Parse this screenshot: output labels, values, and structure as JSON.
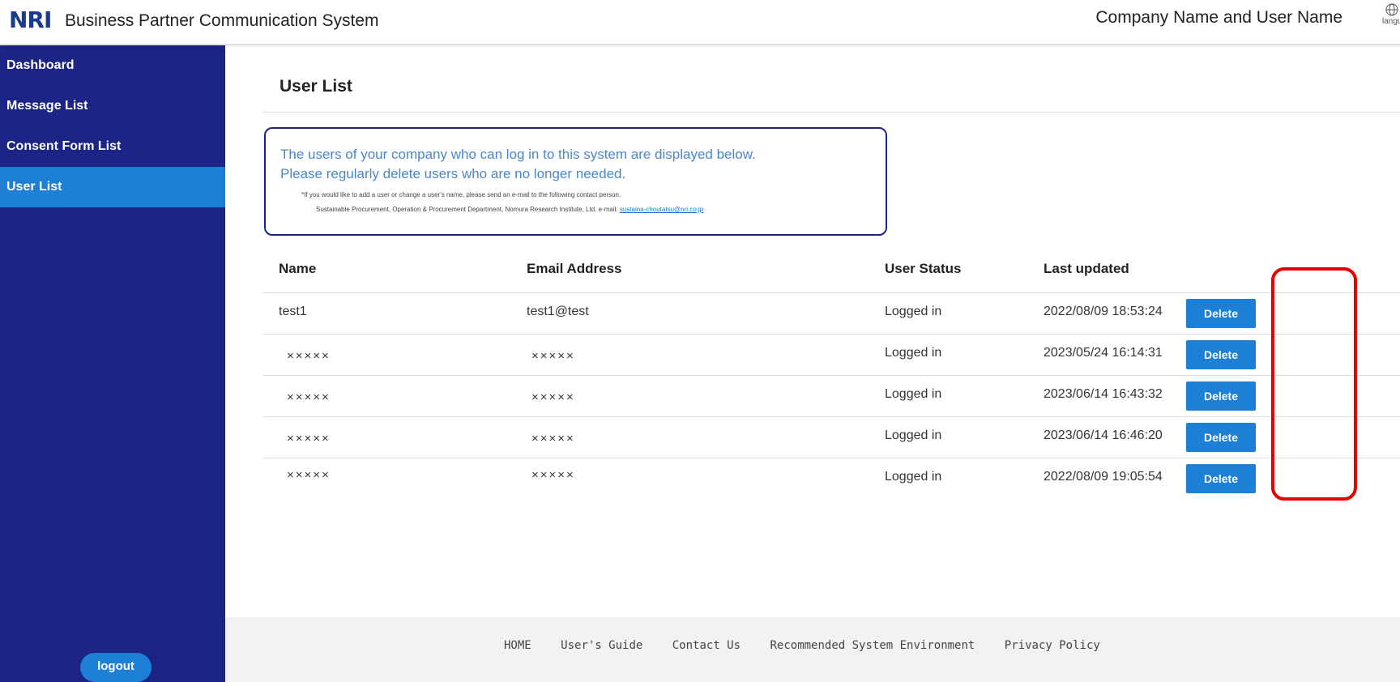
{
  "header": {
    "logo": "NRI",
    "system_title": "Business Partner Communication System",
    "user_label": "Company Name and User Name",
    "language_label": "langu"
  },
  "sidebar": {
    "items": [
      {
        "label": "Dashboard",
        "active": false
      },
      {
        "label": "Message List",
        "active": false
      },
      {
        "label": "Consent Form List",
        "active": false
      },
      {
        "label": "User List",
        "active": true
      }
    ],
    "logout_label": "logout"
  },
  "main": {
    "page_title": "User List",
    "info": {
      "line1": "The users of your company who can log in to this system are displayed below.",
      "line2": "Please regularly delete users who are no longer needed.",
      "note": "*If you would like to add a user or change a user's name, please send an e-mail to the following contact person.",
      "contact_prefix": "Sustainable Procurement, Operation & Procurement Department, Nomura Research Institute, Ltd. e-mail:",
      "contact_email": "sustaina-choutatsu@nri.co.jp"
    },
    "table": {
      "headers": {
        "name": "Name",
        "email": "Email Address",
        "status": "User Status",
        "updated": "Last updated"
      },
      "delete_label": "Delete",
      "rows": [
        {
          "name": "test1",
          "email": "test1@test",
          "status": "Logged in",
          "updated": "2022/08/09 18:53:24"
        },
        {
          "name": "×××××",
          "email": "×××××",
          "status": "Logged in",
          "updated": "2023/05/24 16:14:31"
        },
        {
          "name": "×××××",
          "email": "×××××",
          "status": "Logged in",
          "updated": "2023/06/14 16:43:32"
        },
        {
          "name": "×××××",
          "email": "×××××",
          "status": "Logged in",
          "updated": "2023/06/14 16:46:20"
        },
        {
          "name": "×××××",
          "email": "×××××",
          "status": "Logged in",
          "updated": "2022/08/09 19:05:54"
        }
      ]
    }
  },
  "footer": {
    "links": [
      "HOME",
      "User's Guide",
      "Contact Us",
      "Recommended System Environment",
      "Privacy Policy"
    ]
  },
  "colors": {
    "sidebar_bg": "#1c2485",
    "accent": "#1e7fd6",
    "highlight": "#e60000",
    "info_text": "#4a86c8"
  }
}
